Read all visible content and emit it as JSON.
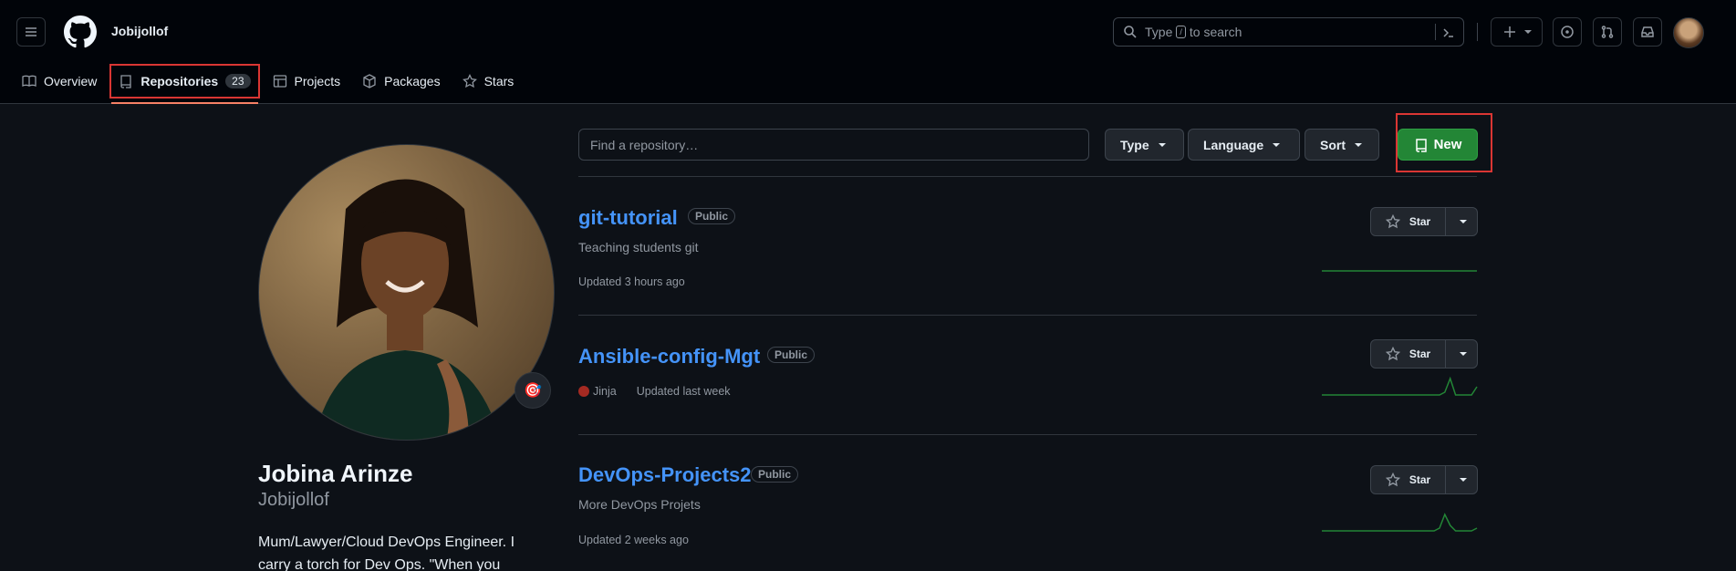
{
  "header": {
    "username": "Jobijollof",
    "search_placeholder_prefix": "Type",
    "search_key": "/",
    "search_placeholder_suffix": "to search"
  },
  "tabs": [
    {
      "label": "Overview",
      "icon": "book-icon"
    },
    {
      "label": "Repositories",
      "icon": "repo-icon",
      "count": "23",
      "active": true
    },
    {
      "label": "Projects",
      "icon": "table-icon"
    },
    {
      "label": "Packages",
      "icon": "package-icon"
    },
    {
      "label": "Stars",
      "icon": "star-icon"
    }
  ],
  "profile": {
    "full_name": "Jobina Arinze",
    "login": "Jobijollof",
    "bio_line1": "Mum/Lawyer/Cloud DevOps Engineer. I",
    "bio_line2": "carry a torch for Dev Ops. \"When you",
    "status_emoji": "🎯"
  },
  "toolbar": {
    "find_placeholder": "Find a repository…",
    "type_label": "Type",
    "language_label": "Language",
    "sort_label": "Sort",
    "new_label": "New"
  },
  "repos": [
    {
      "name": "git-tutorial",
      "visibility": "Public",
      "description": "Teaching students git",
      "language": "",
      "updated": "Updated 3 hours ago",
      "star_label": "Star",
      "activity": [
        0,
        0,
        0,
        0,
        0,
        0,
        0,
        0,
        0,
        0,
        0,
        0,
        0,
        0,
        0,
        0,
        0,
        0,
        0,
        0,
        0,
        0,
        0,
        0,
        0,
        0,
        0,
        0,
        0,
        0
      ]
    },
    {
      "name": "Ansible-config-Mgt",
      "visibility": "Public",
      "description": "",
      "language": "Jinja",
      "language_color": "#a52a22",
      "updated": "Updated last week",
      "star_label": "Star",
      "activity": [
        0,
        0,
        0,
        0,
        0,
        0,
        0,
        0,
        0,
        0,
        0,
        0,
        0,
        0,
        0,
        0,
        0,
        0,
        0,
        0,
        0,
        0,
        0,
        1,
        6,
        0,
        0,
        0,
        0,
        3
      ]
    },
    {
      "name": "DevOps-Projects2",
      "visibility": "Public",
      "description": "More DevOps Projets",
      "language": "",
      "updated": "Updated 2 weeks ago",
      "star_label": "Star",
      "activity": [
        0,
        0,
        0,
        0,
        0,
        0,
        0,
        0,
        0,
        0,
        0,
        0,
        0,
        0,
        0,
        0,
        0,
        0,
        0,
        0,
        0,
        0,
        1,
        6,
        2,
        0,
        0,
        0,
        0,
        1
      ]
    }
  ],
  "colors": {
    "accent": "#4493f8",
    "primary_button": "#238636",
    "highlight_box": "#da3633",
    "sparkline": "#238636"
  }
}
